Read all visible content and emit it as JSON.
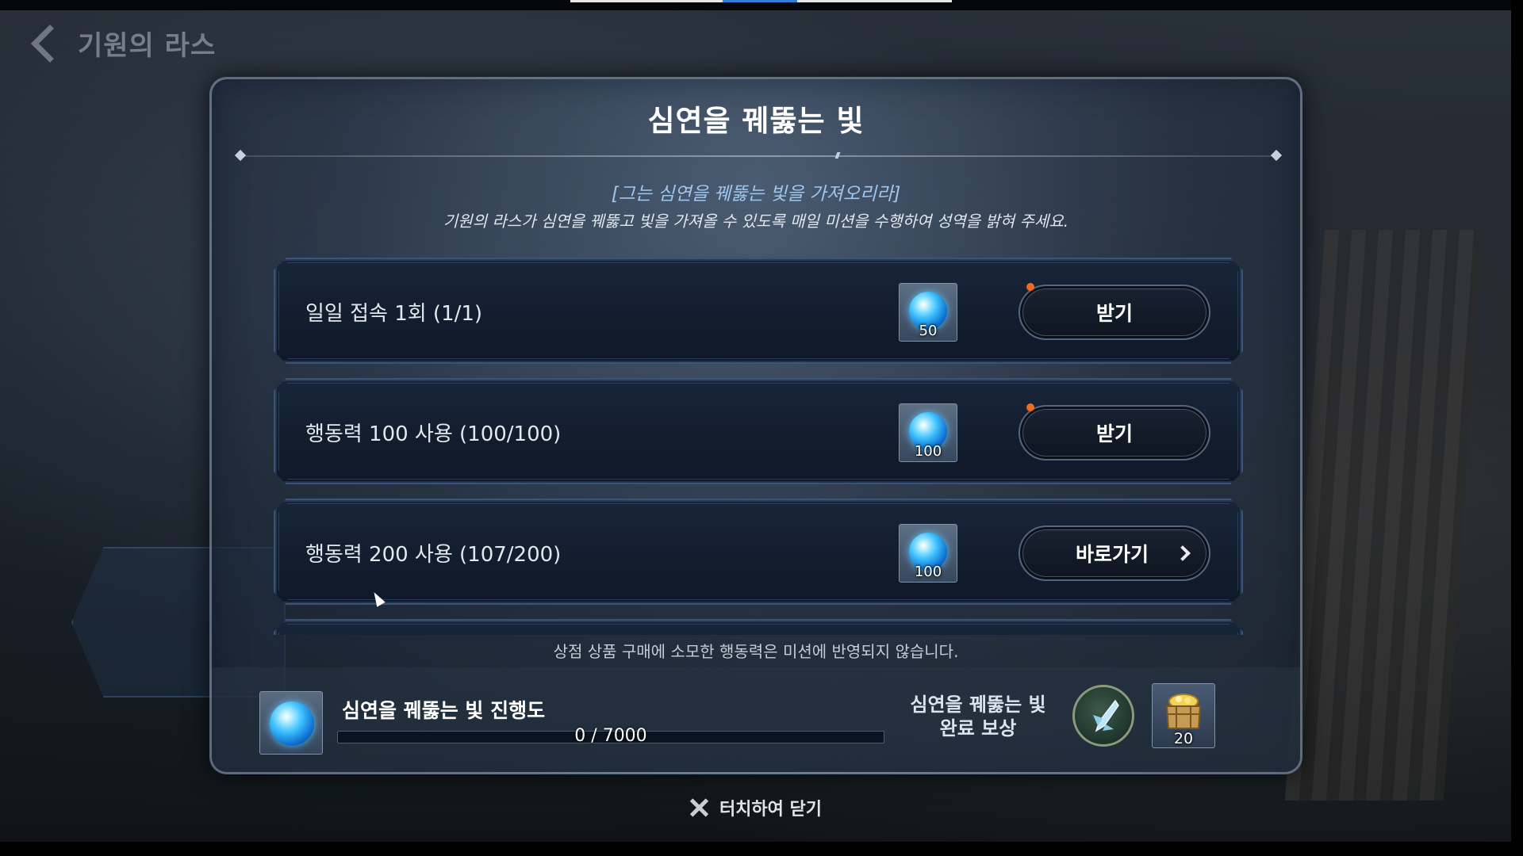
{
  "header": {
    "back_title": "기원의 라스"
  },
  "dialog": {
    "title": "심연을 꿰뚫는 빛",
    "quote": "[그는 심연을 꿰뚫는 빛을 가져오리라]",
    "description": "기원의 라스가 심연을 꿰뚫고 빛을 가져올 수 있도록 매일 미션을 수행하여 성역을 밝혀 주세요.",
    "missions": [
      {
        "label": "일일 접속 1회 (1/1)",
        "reward_count": "50",
        "button_label": "받기",
        "has_notification": true
      },
      {
        "label": "행동력 100 사용 (100/100)",
        "reward_count": "100",
        "button_label": "받기",
        "has_notification": true
      },
      {
        "label": "행동력 200 사용 (107/200)",
        "reward_count": "100",
        "button_label": "바로가기",
        "has_notification": false
      }
    ],
    "notice": "상점 상품 구매에 소모한 행동력은 미션에 반영되지 않습니다.",
    "progress": {
      "label": "심연을 꿰뚫는 빛 진행도",
      "text": "0 / 7000",
      "current": 0,
      "max": 7000
    },
    "completion_reward": {
      "title_line1": "심연을 꿰뚫는 빛",
      "title_line2": "완료 보상",
      "chest_count": "20"
    }
  },
  "close": {
    "label": "터치하여 닫기"
  },
  "icons": {
    "reward_orb": "blue-orb-icon",
    "emblem": "crystal-emblem-icon",
    "chest": "treasure-chest-icon",
    "close": "close-icon",
    "back": "chevron-left-icon",
    "arrow": "chevron-right-icon"
  },
  "colors": {
    "accent_blue": "#3aa0ff",
    "notification": "#f26a1b",
    "quote_text": "#9fc6ee"
  }
}
